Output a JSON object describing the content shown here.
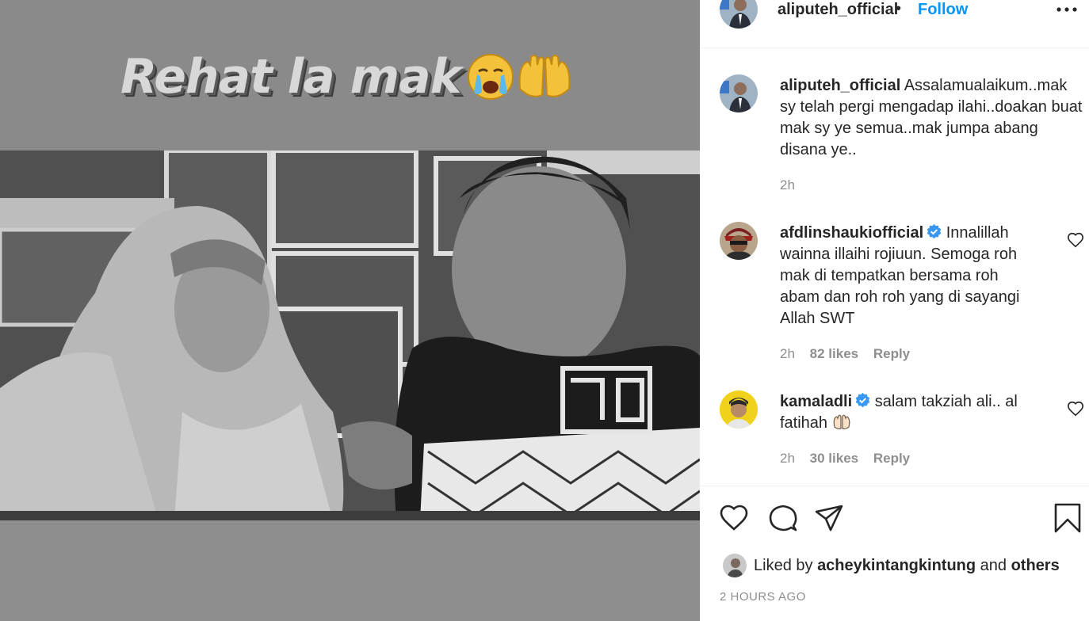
{
  "media": {
    "overlay_text": "Rehat la mak",
    "emojis": [
      "crying-face",
      "raised-hands"
    ]
  },
  "post": {
    "username": "aliputeh_official",
    "separator": "•",
    "follow_label": "Follow",
    "caption": {
      "username": "aliputeh_official",
      "text": "Assalamualaikum..mak sy telah pergi mengadap ilahi..doakan buat mak sy ye semua..mak jumpa abang disana ye..",
      "time": "2h"
    }
  },
  "comments": [
    {
      "username": "afdlinshaukiofficial",
      "verified": true,
      "text": "Innalillah wainna illaihi rojiuun. Semoga roh mak di tempatkan bersama roh abam dan roh roh yang di sayangi Allah SWT",
      "time": "2h",
      "likes": "82 likes",
      "reply": "Reply"
    },
    {
      "username": "kamaladli",
      "verified": true,
      "text": "salam takziah ali.. al fatihah",
      "emoji": "open-hands",
      "time": "2h",
      "likes": "30 likes",
      "reply": "Reply"
    }
  ],
  "likes": {
    "prefix": "Liked by",
    "user": "acheykintangkintung",
    "conjunction": "and",
    "others": "others"
  },
  "timestamp": "2 HOURS AGO",
  "colors": {
    "accent": "#0095f6",
    "text": "#262626",
    "muted": "#8e8e8e",
    "verified": "#3897f0"
  }
}
